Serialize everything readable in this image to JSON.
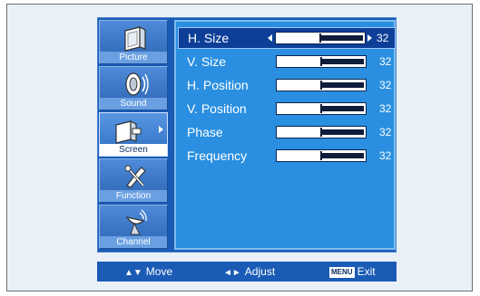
{
  "categories": [
    {
      "label": "Picture",
      "icon": "picture-icon"
    },
    {
      "label": "Sound",
      "icon": "sound-icon"
    },
    {
      "label": "Screen",
      "icon": "screen-icon",
      "active": true
    },
    {
      "label": "Function",
      "icon": "function-icon"
    },
    {
      "label": "Channel",
      "icon": "channel-icon"
    }
  ],
  "settings": [
    {
      "name": "H. Size",
      "value": "32",
      "selected": true
    },
    {
      "name": "V. Size",
      "value": "32"
    },
    {
      "name": "H. Position",
      "value": "32"
    },
    {
      "name": "V. Position",
      "value": "32"
    },
    {
      "name": "Phase",
      "value": "32"
    },
    {
      "name": "Frequency",
      "value": "32"
    }
  ],
  "slider_level": 0.5,
  "help": {
    "move_glyph": "▲▼",
    "move": "Move",
    "adjust_glyph": "◄►",
    "adjust": "Adjust",
    "menu_badge": "MENU",
    "exit": "Exit"
  },
  "colors": {
    "panel": "#1a5bb6",
    "settings_bg": "#2a8fe0",
    "selected_row": "#0d3f98"
  }
}
